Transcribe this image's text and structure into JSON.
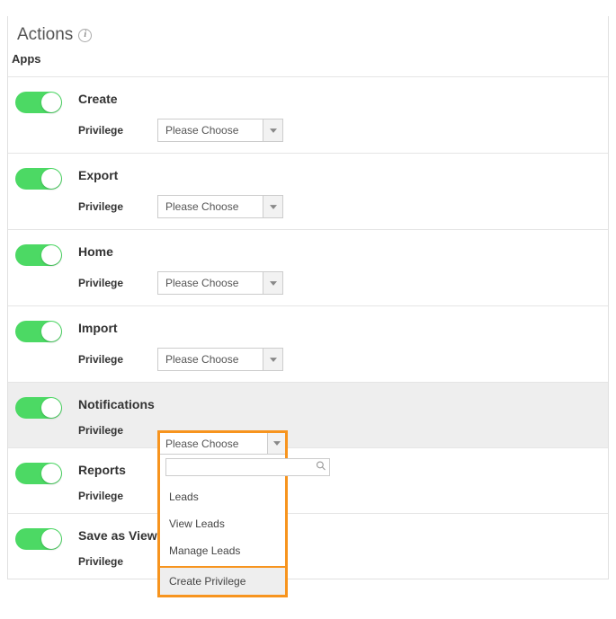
{
  "section": {
    "title": "Actions",
    "info_glyph": "i",
    "subsection": "Apps"
  },
  "privilege_label": "Privilege",
  "select_placeholder": "Please Choose",
  "actions": [
    {
      "id": "create",
      "title": "Create"
    },
    {
      "id": "export",
      "title": "Export"
    },
    {
      "id": "home",
      "title": "Home"
    },
    {
      "id": "import",
      "title": "Import"
    },
    {
      "id": "notifications",
      "title": "Notifications"
    },
    {
      "id": "reports",
      "title": "Reports"
    },
    {
      "id": "save-as-view",
      "title": "Save as View"
    }
  ],
  "dropdown": {
    "selected": "Please Choose",
    "search_value": "",
    "options": [
      {
        "label": "Leads"
      },
      {
        "label": "View Leads"
      },
      {
        "label": "Manage Leads"
      }
    ],
    "create_label": "Create Privilege"
  }
}
